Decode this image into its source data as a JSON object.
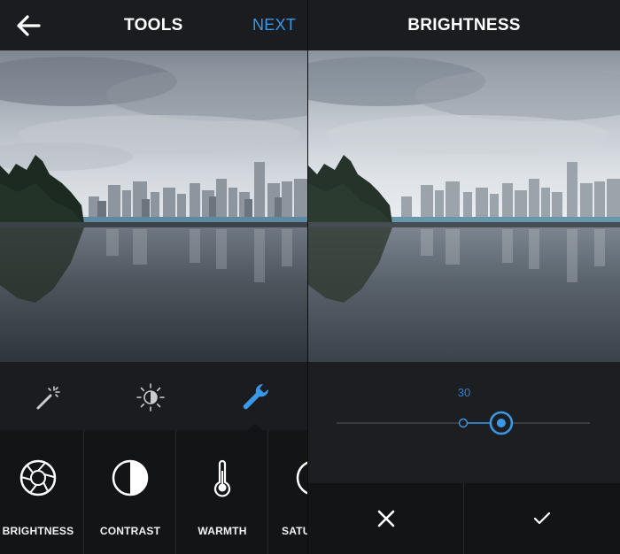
{
  "tools_screen": {
    "title": "TOOLS",
    "next_label": "NEXT",
    "tabs": [
      {
        "icon": "magic-wand-icon"
      },
      {
        "icon": "brightness-contrast-icon"
      },
      {
        "icon": "wrench-icon",
        "active": true
      }
    ],
    "tools": [
      {
        "label": "BRIGHTNESS",
        "icon": "aperture-icon"
      },
      {
        "label": "CONTRAST",
        "icon": "contrast-icon"
      },
      {
        "label": "WARMTH",
        "icon": "thermometer-icon"
      },
      {
        "label": "SATU",
        "icon": "saturation-icon"
      }
    ]
  },
  "brightness_screen": {
    "title": "BRIGHTNESS",
    "slider": {
      "value": "30",
      "position_fraction": 0.65,
      "default_fraction": 0.5
    }
  },
  "colors": {
    "accent": "#3b98e7",
    "background": "#1c1e21",
    "dark": "#121416"
  }
}
